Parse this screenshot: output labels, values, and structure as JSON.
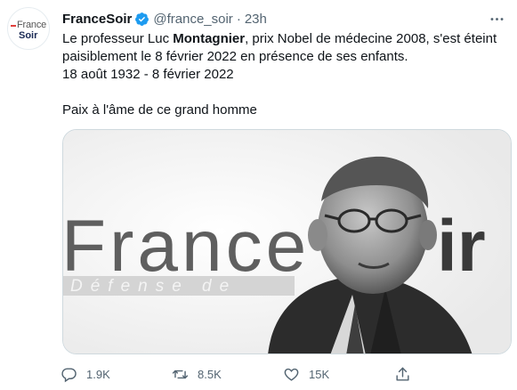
{
  "tweet": {
    "author": {
      "avatar_text_1": "France",
      "avatar_text_2": "Soir",
      "display_name": "FranceSoir",
      "handle": "@france_soir",
      "separator": "·",
      "time": "23h"
    },
    "text": {
      "part1": "Le professeur Luc ",
      "bold": "Montagnier",
      "part2": ", prix Nobel de médecine 2008, s'est éteint paisiblement le 8 février 2022 en présence de ses enfants.",
      "dates": "18 août 1932 - 8 février 2022",
      "tribute": "Paix à l'âme de ce grand homme"
    },
    "media": {
      "bg_word": "France",
      "bg_word_2": "ir",
      "bg_subtitle": "Défense de"
    },
    "actions": {
      "replies": "1.9K",
      "retweets": "8.5K",
      "likes": "15K"
    }
  },
  "colors": {
    "verified": "#1d9bf0",
    "muted": "#536471",
    "brand_red": "#e0403c"
  }
}
